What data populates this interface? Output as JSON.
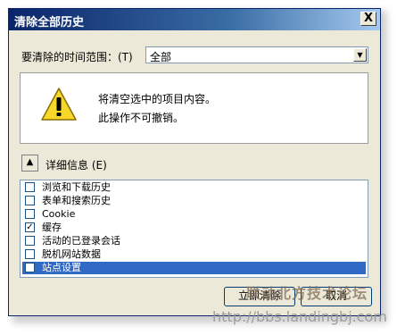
{
  "window": {
    "title": "清除全部历史",
    "close_glyph": "X"
  },
  "range": {
    "label": "要清除的时间范围：(T)",
    "selected": "全部"
  },
  "warning": {
    "icon": "warning-icon",
    "line1": "将清空选中的项目内容。",
    "line2": "此操作不可撤销。"
  },
  "details": {
    "toggle_glyph": "▲",
    "label": "详细信息 (E)"
  },
  "items": [
    {
      "label": "浏览和下载历史",
      "checked": false,
      "selected": false
    },
    {
      "label": "表单和搜索历史",
      "checked": false,
      "selected": false
    },
    {
      "label": "Cookie",
      "checked": false,
      "selected": false
    },
    {
      "label": "缓存",
      "checked": true,
      "selected": false
    },
    {
      "label": "活动的已登录会话",
      "checked": false,
      "selected": false
    },
    {
      "label": "脱机网站数据",
      "checked": false,
      "selected": false
    },
    {
      "label": "站点设置",
      "checked": false,
      "selected": true
    }
  ],
  "buttons": {
    "clear_now": "立即清除",
    "cancel": "取消"
  },
  "watermark": {
    "text1": "联动北方技术论坛",
    "text2": "http://bbs.landingbj.com"
  }
}
